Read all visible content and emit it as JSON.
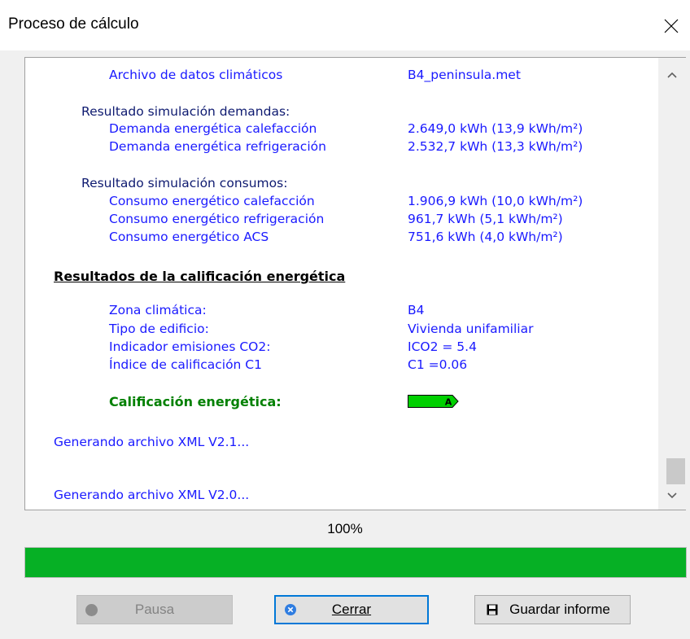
{
  "window": {
    "title": "Proceso de cálculo"
  },
  "log": {
    "climate_file_label": "Archivo de datos climáticos",
    "climate_file_value": "B4_peninsula.met",
    "demand_heading": "Resultado simulación demandas:",
    "demand_heating_label": "Demanda energética calefacción",
    "demand_heating_value": "2.649,0 kWh (13,9 kWh/m²)",
    "demand_cooling_label": "Demanda energética refrigeración",
    "demand_cooling_value": "2.532,7 kWh (13,3 kWh/m²)",
    "consumption_heading": "Resultado simulación consumos:",
    "consumption_heating_label": "Consumo energético calefacción",
    "consumption_heating_value": "1.906,9 kWh (10,0 kWh/m²)",
    "consumption_cooling_label": "Consumo energético refrigeración",
    "consumption_cooling_value": "961,7 kWh (5,1 kWh/m²)",
    "consumption_acs_label": "Consumo energético ACS",
    "consumption_acs_value": "751,6 kWh (4,0 kWh/m²)",
    "rating_section_heading": "Resultados de la calificación energética",
    "climate_zone_label": "Zona climática:",
    "climate_zone_value": "B4",
    "building_type_label": "Tipo de edificio:",
    "building_type_value": "Vivienda unifamiliar",
    "emissions_label": "Indicador emisiones CO2:",
    "emissions_value": "ICO2 = 5.4",
    "rating_index_label": "Índice de calificación C1",
    "rating_index_value": "C1 =0.06",
    "energy_rating_label": "Calificación energética:",
    "energy_rating_value": "A",
    "energy_rating_color": "#00d000",
    "xml_v21": "Generando archivo XML V2.1...",
    "xml_v20": "Generando archivo XML V2.0..."
  },
  "progress": {
    "label": "100%",
    "value": 1.0,
    "color": "#06b025"
  },
  "buttons": {
    "pause": "Pausa",
    "close": "Cerrar",
    "save_report": "Guardar informe"
  }
}
